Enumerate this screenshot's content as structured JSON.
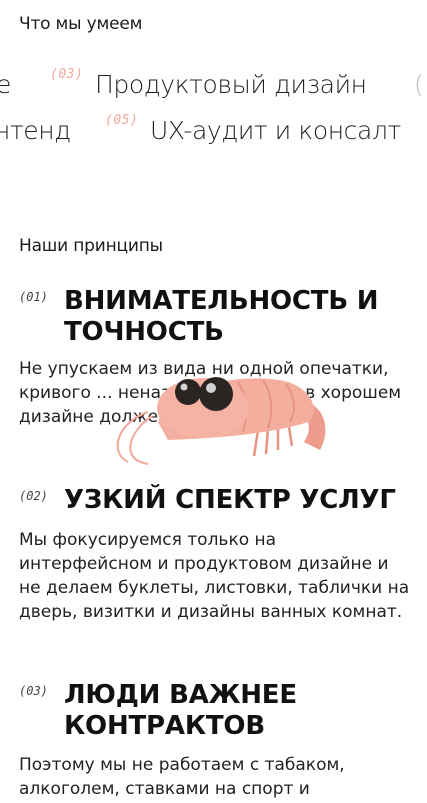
{
  "skills": {
    "heading": "Что мы умеем",
    "row1": [
      {
        "num": "",
        "label": "е"
      },
      {
        "num": "(03)",
        "label": "Продуктовый дизайн"
      },
      {
        "num": "",
        "label": "("
      }
    ],
    "row2": [
      {
        "num": "",
        "label": "нтенд"
      },
      {
        "num": "(05)",
        "label": "UX-аудит и консалт"
      }
    ]
  },
  "principles": {
    "heading": "Наши принципы",
    "items": [
      {
        "num": "(01)",
        "title": "ВНИМАТЕЛЬНОСТЬ И ТОЧНОСТЬ",
        "text": "Не упускаем из вида ни одной опечатки, кривого ... неназванного ... что в хорошем дизайне должен быть порядок."
      },
      {
        "num": "(02)",
        "title": "УЗКИЙ СПЕКТР УСЛУГ",
        "text": "Мы фокусируемся только на интерфейсном и продуктовом дизайне и не делаем буклеты, листовки, таблички на дверь, визитки и дизайны ванных комнат."
      },
      {
        "num": "(03)",
        "title": "ЛЮДИ ВАЖНЕЕ КОНТРАКТОВ",
        "text": "Поэтому мы не работаем с табаком, алкоголем, ставками на спорт и"
      }
    ]
  },
  "colors": {
    "accent": "#f0a8a0",
    "shrimp": "#f2a898",
    "text": "#1b1b1b"
  },
  "icons": {
    "mascot": "shrimp-mascot-icon"
  }
}
